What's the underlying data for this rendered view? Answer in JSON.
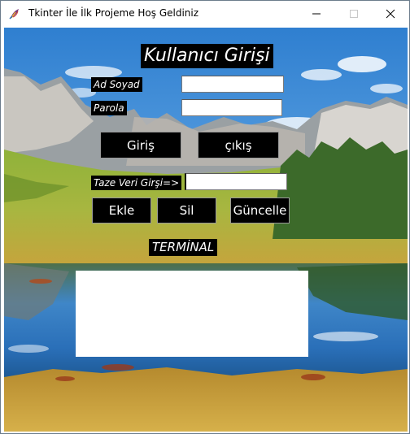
{
  "window": {
    "title": "Tkinter İle İlk Projeme Hoş Geldiniz",
    "icon": "feather-icon"
  },
  "form": {
    "heading": "Kullanıcı Girişi",
    "name_label": "Ad Soyad",
    "name_value": "",
    "password_label": "Parola",
    "password_value": "",
    "login_button": "Giriş",
    "exit_button": "çıkış",
    "new_data_label": "Taze Veri Girşi=>",
    "new_data_value": "",
    "add_button": "Ekle",
    "delete_button": "Sil",
    "update_button": "Güncelle",
    "terminal_label": "TERMİNAL",
    "terminal_output": ""
  },
  "colors": {
    "label_bg": "#000000",
    "label_fg": "#ffffff",
    "entry_bg": "#ffffff"
  }
}
